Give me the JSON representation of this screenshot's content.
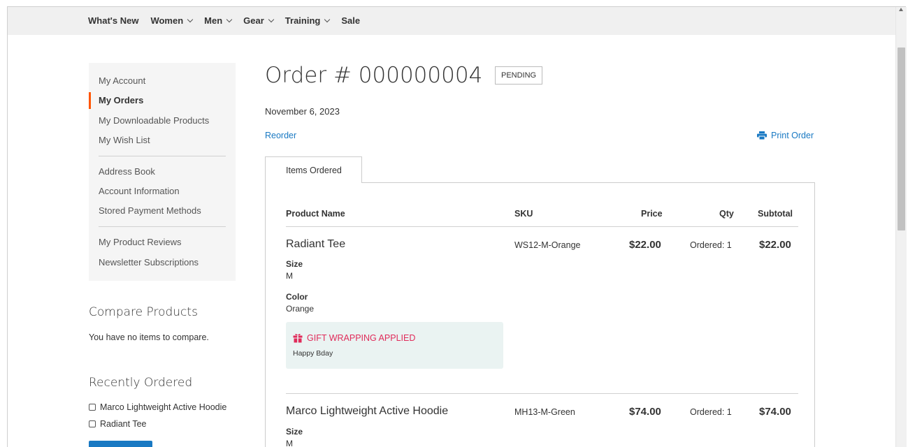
{
  "nav": {
    "items": [
      {
        "label": "What's New",
        "dropdown": false
      },
      {
        "label": "Women",
        "dropdown": true
      },
      {
        "label": "Men",
        "dropdown": true
      },
      {
        "label": "Gear",
        "dropdown": true
      },
      {
        "label": "Training",
        "dropdown": true
      },
      {
        "label": "Sale",
        "dropdown": false
      }
    ]
  },
  "sidebar": {
    "items": [
      {
        "label": "My Account"
      },
      {
        "label": "My Orders",
        "active": true
      },
      {
        "label": "My Downloadable Products"
      },
      {
        "label": "My Wish List"
      },
      {
        "label": "Address Book"
      },
      {
        "label": "Account Information"
      },
      {
        "label": "Stored Payment Methods"
      },
      {
        "label": "My Product Reviews"
      },
      {
        "label": "Newsletter Subscriptions"
      }
    ],
    "accent_color": "#ff5501"
  },
  "compare": {
    "title": "Compare Products",
    "empty_text": "You have no items to compare."
  },
  "recently_ordered": {
    "title": "Recently Ordered",
    "items": [
      "Marco Lightweight Active Hoodie",
      "Radiant Tee"
    ]
  },
  "order": {
    "title": "Order # 000000004",
    "status": "PENDING",
    "date": "November 6, 2023",
    "reorder_label": "Reorder",
    "print_label": "Print Order",
    "print_icon": "printer-icon",
    "link_color": "#1979c3"
  },
  "tabs": {
    "active": "Items Ordered"
  },
  "table": {
    "headers": {
      "product": "Product Name",
      "sku": "SKU",
      "price": "Price",
      "qty": "Qty",
      "subtotal": "Subtotal"
    },
    "items": [
      {
        "name": "Radiant Tee",
        "sku": "WS12-M-Orange",
        "price": "$22.00",
        "qty": "Ordered: 1",
        "subtotal": "$22.00",
        "options": [
          {
            "label": "Size",
            "value": "M"
          },
          {
            "label": "Color",
            "value": "Orange"
          }
        ],
        "gift": {
          "title": "GIFT WRAPPING APPLIED",
          "message": "Happy Bday",
          "icon": "gift-icon",
          "color": "#e02b5a"
        }
      },
      {
        "name": "Marco Lightweight Active Hoodie",
        "sku": "MH13-M-Green",
        "price": "$74.00",
        "qty": "Ordered: 1",
        "subtotal": "$74.00",
        "options": [
          {
            "label": "Size",
            "value": "M"
          }
        ]
      }
    ]
  }
}
